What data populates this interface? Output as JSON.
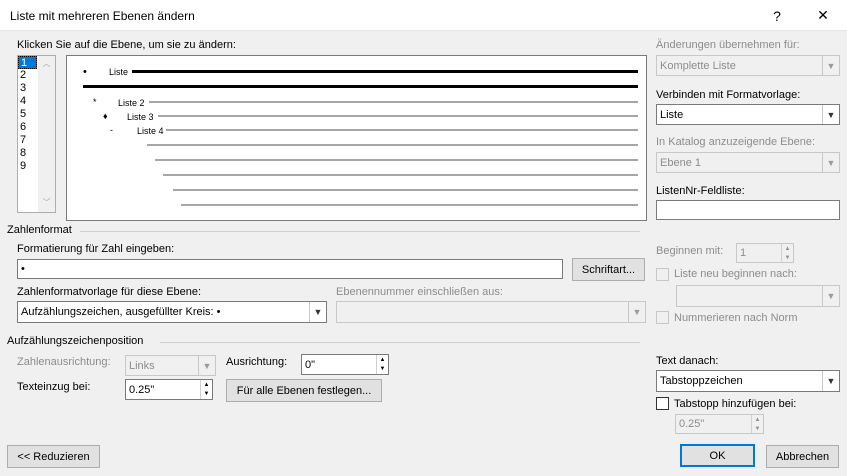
{
  "window": {
    "title": "Liste mit mehreren Ebenen ändern",
    "help_label": "?",
    "close_label": "✕"
  },
  "level_section": {
    "label": "Klicken Sie auf die Ebene, um sie zu ändern:",
    "levels": [
      "1",
      "2",
      "3",
      "4",
      "5",
      "6",
      "7",
      "8",
      "9"
    ],
    "selected": "1"
  },
  "preview": {
    "items": [
      {
        "bullet": "•",
        "label": "Liste"
      },
      {
        "bullet": "*",
        "label": "Liste 2"
      },
      {
        "bullet": "♦",
        "label": "Liste 3"
      },
      {
        "bullet": "-",
        "label": "Liste 4"
      }
    ]
  },
  "right_panel": {
    "apply_label": "Änderungen übernehmen für:",
    "apply_value": "Komplette Liste",
    "link_label": "Verbinden mit Formatvorlage:",
    "link_value": "Liste",
    "gallery_label": "In Katalog anzuzeigende Ebene:",
    "gallery_value": "Ebene 1",
    "listnum_label": "ListenNr-Feldliste:",
    "listnum_value": ""
  },
  "number_format": {
    "group_label": "Zahlenformat",
    "format_label": "Formatierung für Zahl eingeben:",
    "format_value": "•",
    "font_button": "Schriftart...",
    "style_label": "Zahlenformatvorlage für diese Ebene:",
    "style_value": "Aufzählungszeichen, ausgefüllter Kreis: •",
    "include_label": "Ebenennummer einschließen aus:",
    "include_value": "",
    "start_label": "Beginnen mit:",
    "start_value": "1",
    "restart_label": "Liste neu beginnen nach:",
    "restart_value": "",
    "legal_label": "Nummerieren nach Norm"
  },
  "position": {
    "group_label": "Aufzählungszeichenposition",
    "alignment_label": "Zahlenausrichtung:",
    "alignment_value": "Links",
    "aligned_at_label": "Ausrichtung:",
    "aligned_at_value": "0\"",
    "indent_label": "Texteinzug bei:",
    "indent_value": "0.25\"",
    "set_all_button": "Für alle Ebenen festlegen...",
    "follow_label": "Text danach:",
    "follow_value": "Tabstoppzeichen",
    "tabstop_label": "Tabstopp hinzufügen bei:",
    "tabstop_value": "0.25\""
  },
  "footer": {
    "less_button": "<< Reduzieren",
    "ok_button": "OK",
    "cancel_button": "Abbrechen"
  },
  "colors": {
    "accent": "#0078d7",
    "dialog_bg": "#f0f0f0"
  }
}
